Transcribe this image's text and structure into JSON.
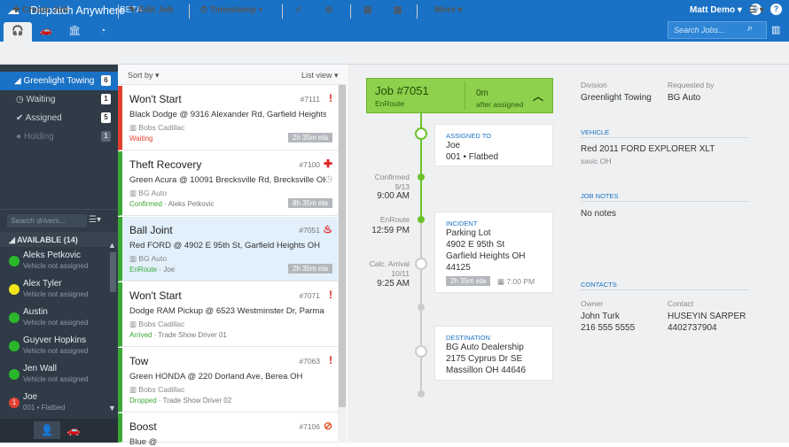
{
  "header": {
    "app_name": "Dispatch Anywhere",
    "beta": "BETA",
    "user": "Matt Demo",
    "search_placeholder": "Search Jobs...",
    "tabs": [
      "headset",
      "car",
      "bank",
      "pie"
    ]
  },
  "toolbar": {
    "create_job": "Create Job",
    "edit_job": "Edit Job",
    "timestamp": "Timestamp",
    "more": "More"
  },
  "sidebar": {
    "items": [
      {
        "label": "Greenlight Towing",
        "count": "6"
      },
      {
        "label": "Waiting",
        "count": "1"
      },
      {
        "label": "Assigned",
        "count": "5"
      },
      {
        "label": "Holding",
        "count": "1"
      }
    ],
    "driver_search_placeholder": "Search drivers...",
    "available_header": "AVAILABLE (14)",
    "drivers": [
      {
        "name": "Aleks Petkovic",
        "status": "Vehicle not assigned",
        "color": "#2ab82a"
      },
      {
        "name": "Alex Tyler",
        "status": "Vehicle not assigned",
        "color": "#f2e51a"
      },
      {
        "name": "Austin",
        "status": "Vehicle not assigned",
        "color": "#2ab82a"
      },
      {
        "name": "Guyver Hopkins",
        "status": "Vehicle not assigned",
        "color": "#2ab82a"
      },
      {
        "name": "Jen Wall",
        "status": "Vehicle not assigned",
        "color": "#2ab82a"
      },
      {
        "name": "Joe",
        "status": "001 • Flatbed",
        "color": "#e04030",
        "badge": "1"
      }
    ]
  },
  "joblist": {
    "sort_label": "Sort by",
    "view_label": "List view",
    "jobs": [
      {
        "title": "Won't Start",
        "number": "#7111",
        "icon": "!",
        "icon_color": "#e02020",
        "vehicle": "Black Dodge @ 9316 Alexander Rd, Garfield Heights OH",
        "company": "Bobs Cadillac",
        "status": "Waiting",
        "status_color": "#e04030",
        "driver": "",
        "eta": "2h 35m eta",
        "bar": "#e04030"
      },
      {
        "title": "Theft Recovery",
        "number": "#7100",
        "icon": "✚",
        "icon_color": "#e02020",
        "vehicle": "Green Acura @ 10091 Brecksville Rd, Brecksville OH",
        "company": "BG Auto",
        "status": "Confirmed",
        "status_color": "#3aa835",
        "driver": " · Aleks Petkovic",
        "eta": "8h 35m eta",
        "bar": "#3aa835"
      },
      {
        "title": "Ball Joint",
        "number": "#7051",
        "icon": "♨",
        "icon_color": "#e02020",
        "vehicle": "Red FORD @ 4902 E 95th St, Garfield Heights OH",
        "company": "BG Auto",
        "status": "EnRoute",
        "status_color": "#3aa835",
        "driver": " · Joe",
        "eta": "2h 35m eta",
        "bar": "#3aa835"
      },
      {
        "title": "Won't Start",
        "number": "#7071",
        "icon": "!",
        "icon_color": "#e02020",
        "vehicle": "Dodge RAM Pickup @ 6523 Westminster Dr, Parma OH",
        "company": "Bobs Cadillac",
        "status": "Arrived",
        "status_color": "#3aa835",
        "driver": " · Trade Show Driver 01",
        "eta": "",
        "bar": "#3aa835"
      },
      {
        "title": "Tow",
        "number": "#7063",
        "icon": "!",
        "icon_color": "#e02020",
        "vehicle": "Green HONDA @ 220 Dorland Ave, Berea OH",
        "company": "Bobs Cadillac",
        "status": "Dropped",
        "status_color": "#3aa835",
        "driver": " · Trade Show Driver 02",
        "eta": "",
        "bar": "#3aa835"
      },
      {
        "title": "Boost",
        "number": "#7106",
        "icon": "⊘",
        "icon_color": "#e05020",
        "vehicle": "Blue @",
        "company": "",
        "status": "",
        "status_color": "#3aa835",
        "driver": "",
        "eta": "",
        "bar": "#3aa835"
      }
    ]
  },
  "detail": {
    "job_title": "Job #7051",
    "job_status": "EnRoute",
    "elapsed": "0m",
    "elapsed_label": "after assigned",
    "assigned": {
      "title": "ASSIGNED TO",
      "name": "Joe",
      "truck": "001 • Flatbed"
    },
    "times": {
      "confirmed_label": "Confirmed",
      "confirmed_date": "9/13",
      "confirmed_time": "9:00 AM",
      "enroute_label": "EnRoute",
      "enroute_time": "12:59 PM",
      "arrival_label": "Calc. Arrival",
      "arrival_date": "10/11",
      "arrival_time": "9:25 AM"
    },
    "incident": {
      "title": "INCIDENT",
      "lines": [
        "Parking Lot",
        "4902 E 95th St",
        "Garfield Heights OH",
        "44125"
      ],
      "eta": "2h 35m eta",
      "eta_time": "7:00 PM"
    },
    "destination": {
      "title": "DESTINATION",
      "lines": [
        "BG Auto Dealership",
        "2175 Cyprus Dr SE",
        "Massillon OH 44646"
      ]
    },
    "division_label": "Division",
    "division": "Greenlight Towing",
    "requested_label": "Requested by",
    "requested": "BG Auto",
    "vehicle_title": "VEHICLE",
    "vehicle": "Red 2011 FORD EXPLORER XLT",
    "vehicle_sub": "savic OH",
    "notes_title": "JOB NOTES",
    "notes": "No notes",
    "contacts_title": "CONTACTS",
    "owner_label": "Owner",
    "owner": "John Turk",
    "owner_phone": "216 555 5555",
    "contact_label": "Contact",
    "contact": "HUSEYIN SARPER",
    "contact_phone": "4402737904"
  }
}
